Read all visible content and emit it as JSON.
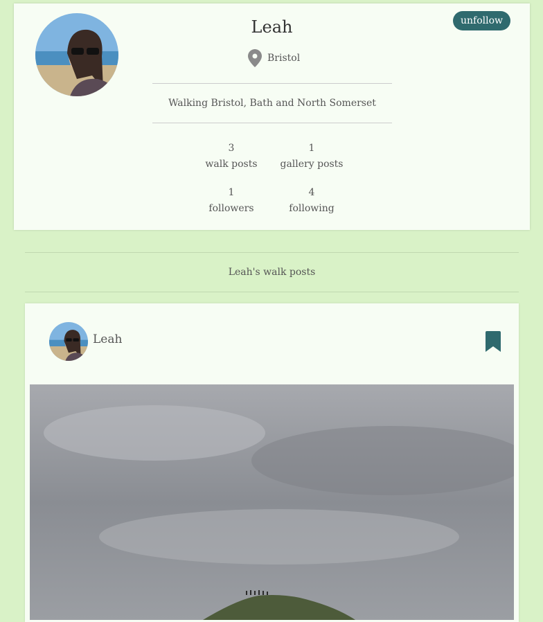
{
  "profile": {
    "name": "Leah",
    "location": "Bristol",
    "bio": "Walking Bristol, Bath and North Somerset",
    "unfollow_label": "unfollow",
    "stats": [
      {
        "value": "3",
        "label": "walk posts"
      },
      {
        "value": "1",
        "label": "gallery posts"
      },
      {
        "value": "1",
        "label": "followers"
      },
      {
        "value": "4",
        "label": "following"
      }
    ]
  },
  "section": {
    "title": "Leah's walk posts"
  },
  "post": {
    "user": "Leah"
  },
  "colors": {
    "background": "#d9f2c7",
    "card": "#f7fdf4",
    "accent": "#2f6a6e"
  },
  "icons": [
    "location-pin-icon",
    "bookmark-icon"
  ]
}
